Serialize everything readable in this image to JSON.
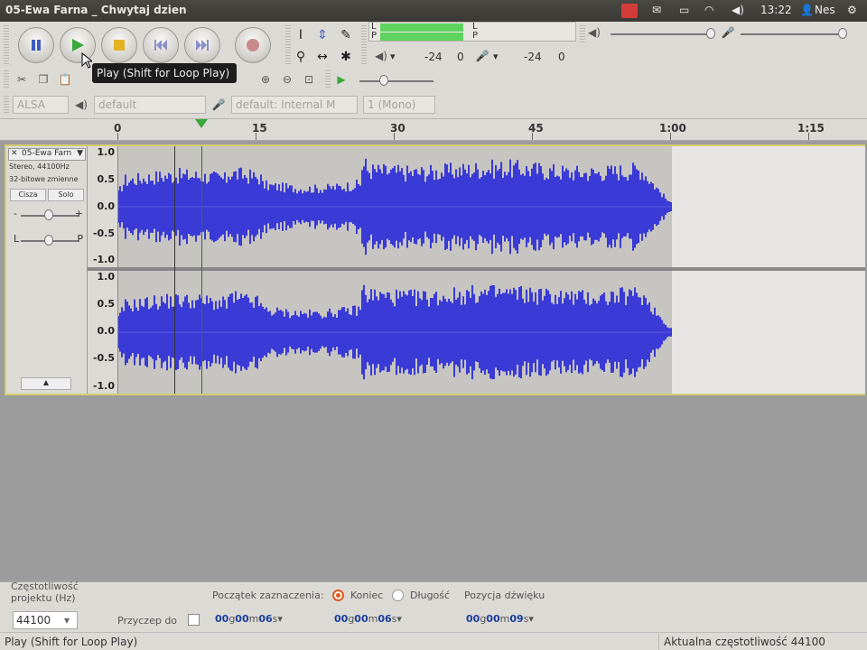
{
  "window": {
    "title": "05-Ewa Farna _ Chwytaj dzien"
  },
  "indicators": {
    "time": "13:22",
    "user": "Nes"
  },
  "transport": {
    "pause_tip": "Pause",
    "play_tip": "Play",
    "stop_tip": "Stop",
    "skip_start_tip": "Skip to Start",
    "skip_end_tip": "Skip to End",
    "record_tip": "Record"
  },
  "tooltip": "Play (Shift for Loop Play)",
  "meters": {
    "left_label": "L",
    "right_label": "P",
    "in_left": "L",
    "in_right": "P",
    "scale_a": "-24",
    "scale_b": "0",
    "scale_c": "-24",
    "scale_d": "0"
  },
  "device": {
    "host": "ALSA",
    "output": "default",
    "input": "default: Internal M",
    "channels": "1 (Mono)"
  },
  "ruler": {
    "ticks": [
      "0",
      "15",
      "30",
      "45",
      "1:00",
      "1:15"
    ]
  },
  "track": {
    "name": "05-Ewa Farn",
    "info1": "Stereo, 44100Hz",
    "info2": "32-bitowe zmienne",
    "mute": "Cisza",
    "solo": "Solo",
    "pan_left": "L",
    "pan_right": "P",
    "scale": [
      "1.0",
      "0.5",
      "0.0",
      "-0.5",
      "-1.0"
    ],
    "collapse": "▲"
  },
  "selection": {
    "rate_label": "Częstotliwość projektu (Hz)",
    "rate_value": "44100",
    "snap_label": "Przyczep do",
    "start_label": "Początek zaznaczenia:",
    "end_label": "Koniec",
    "length_label": "Długość",
    "position_label": "Pozycja dźwięku",
    "start": {
      "h": "00",
      "m": "00",
      "s": "06"
    },
    "end": {
      "h": "00",
      "m": "00",
      "s": "06"
    },
    "position": {
      "h": "00",
      "m": "00",
      "s": "09"
    }
  },
  "status": {
    "left": "Play (Shift for Loop Play)",
    "right": "Aktualna częstotliwość 44100"
  },
  "colors": {
    "wave": "#3a3ad6",
    "accent": "#e05a1a",
    "track_border": "#d4cd72",
    "meter_green": "#5fd35f"
  },
  "icons": [
    "pause-icon",
    "play-icon",
    "stop-icon",
    "skip-start-icon",
    "skip-end-icon",
    "record-icon",
    "selection-tool-icon",
    "envelope-tool-icon",
    "draw-tool-icon",
    "zoom-tool-icon",
    "timeshift-tool-icon",
    "multi-tool-icon",
    "speaker-icon",
    "microphone-icon",
    "mail-icon",
    "battery-icon",
    "wifi-icon",
    "volume-icon",
    "user-icon",
    "gear-icon"
  ]
}
